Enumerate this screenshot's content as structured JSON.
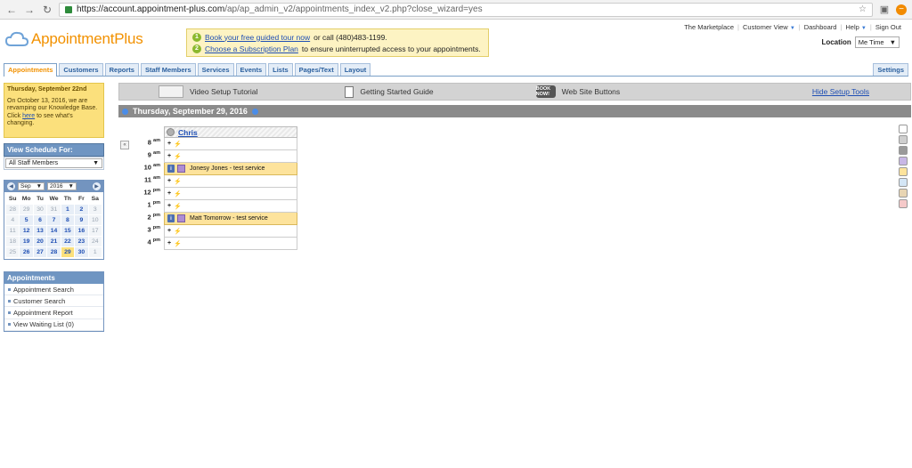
{
  "browser": {
    "url_host": "https://account.appointment-plus.com",
    "url_path": "/ap/ap_admin_v2/appointments_index_v2.php?close_wizard=yes"
  },
  "header": {
    "logo_text": "AppointmentPlus",
    "promo": {
      "line1_num": "1",
      "line1_link": "Book your free guided tour now",
      "line1_rest": "or call (480)483-1199.",
      "line2_num": "2",
      "line2_link": "Choose a Subscription Plan",
      "line2_rest": "to ensure uninterrupted access to your appointments."
    },
    "toplinks": {
      "marketplace": "The Marketplace",
      "customer_view": "Customer View",
      "dashboard": "Dashboard",
      "help": "Help",
      "sign_out": "Sign Out"
    },
    "location_label": "Location",
    "location_value": "Me Time"
  },
  "tabs": {
    "appointments": "Appointments",
    "customers": "Customers",
    "reports": "Reports",
    "staff_members": "Staff Members",
    "services": "Services",
    "events": "Events",
    "lists": "Lists",
    "pages_text": "Pages/Text",
    "layout": "Layout",
    "settings": "Settings"
  },
  "sidebar": {
    "notice_title": "Thursday, September 22nd",
    "notice_body_1": "On October 13, 2016, we are revamping our Knowledge Base. Click",
    "notice_link": "here",
    "notice_body_2": "to see what's changing.",
    "view_schedule_label": "View Schedule For:",
    "view_schedule_value": "All Staff Members",
    "calendar": {
      "month": "Sep",
      "year": "2016",
      "dow": [
        "Su",
        "Mo",
        "Tu",
        "We",
        "Th",
        "Fr",
        "Sa"
      ],
      "days": [
        {
          "d": "28",
          "t": "out"
        },
        {
          "d": "29",
          "t": "out"
        },
        {
          "d": "30",
          "t": "out"
        },
        {
          "d": "31",
          "t": "out"
        },
        {
          "d": "1",
          "t": "in"
        },
        {
          "d": "2",
          "t": "in"
        },
        {
          "d": "3",
          "t": "out"
        },
        {
          "d": "4",
          "t": "out"
        },
        {
          "d": "5",
          "t": "in"
        },
        {
          "d": "6",
          "t": "in"
        },
        {
          "d": "7",
          "t": "in"
        },
        {
          "d": "8",
          "t": "in"
        },
        {
          "d": "9",
          "t": "in"
        },
        {
          "d": "10",
          "t": "out"
        },
        {
          "d": "11",
          "t": "out"
        },
        {
          "d": "12",
          "t": "in"
        },
        {
          "d": "13",
          "t": "in"
        },
        {
          "d": "14",
          "t": "in"
        },
        {
          "d": "15",
          "t": "in"
        },
        {
          "d": "16",
          "t": "in"
        },
        {
          "d": "17",
          "t": "out"
        },
        {
          "d": "18",
          "t": "out"
        },
        {
          "d": "19",
          "t": "in"
        },
        {
          "d": "20",
          "t": "in"
        },
        {
          "d": "21",
          "t": "in"
        },
        {
          "d": "22",
          "t": "in"
        },
        {
          "d": "23",
          "t": "in"
        },
        {
          "d": "24",
          "t": "out"
        },
        {
          "d": "25",
          "t": "out"
        },
        {
          "d": "26",
          "t": "in"
        },
        {
          "d": "27",
          "t": "in"
        },
        {
          "d": "28",
          "t": "in"
        },
        {
          "d": "29",
          "t": "today"
        },
        {
          "d": "30",
          "t": "in"
        },
        {
          "d": "1",
          "t": "out"
        }
      ]
    },
    "appointments_panel": {
      "title": "Appointments",
      "items": [
        "Appointment Search",
        "Customer Search",
        "Appointment Report",
        "View Waiting List (0)"
      ]
    }
  },
  "setup_tools": {
    "video": "Video Setup Tutorial",
    "guide": "Getting Started Guide",
    "now_icon": "BOOK NOW!",
    "buttons": "Web Site Buttons",
    "hide": "Hide Setup Tools"
  },
  "schedule": {
    "date": "Thursday, September 29, 2016",
    "staff": "Chris",
    "hours": [
      {
        "h": "8",
        "ap": "am",
        "appt": ""
      },
      {
        "h": "9",
        "ap": "am",
        "appt": ""
      },
      {
        "h": "10",
        "ap": "am",
        "appt": "Jonesy Jones - test service"
      },
      {
        "h": "11",
        "ap": "am",
        "appt": ""
      },
      {
        "h": "12",
        "ap": "pm",
        "appt": ""
      },
      {
        "h": "1",
        "ap": "pm",
        "appt": ""
      },
      {
        "h": "2",
        "ap": "pm",
        "appt": "Matt Tomorrow - test service"
      },
      {
        "h": "3",
        "ap": "pm",
        "appt": ""
      },
      {
        "h": "4",
        "ap": "pm",
        "appt": ""
      }
    ]
  },
  "swatch_colors": [
    "#ffffff",
    "#cfcfcf",
    "#9a9a9a",
    "#c8b7e6",
    "#fde39c",
    "#d4e6f6",
    "#e8d5b3",
    "#f5c9c9"
  ]
}
